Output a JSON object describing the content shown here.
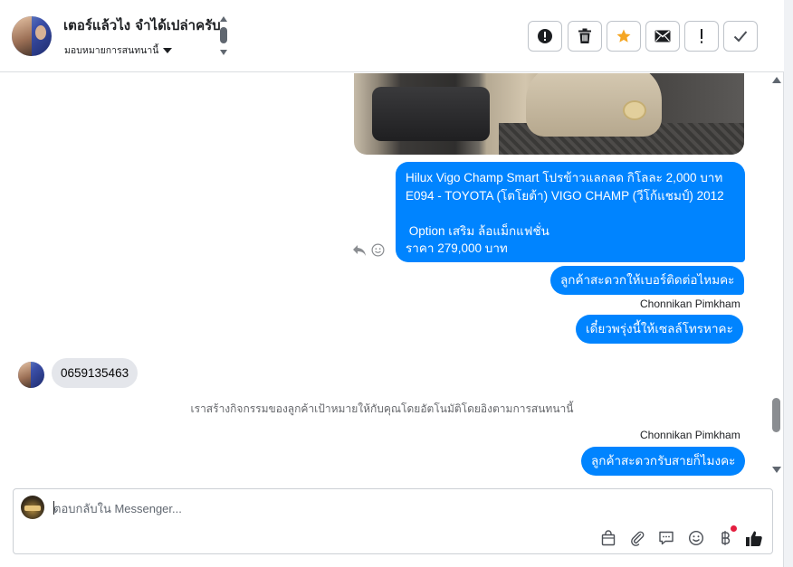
{
  "header": {
    "title": "เตอร์แล้วไง จำได้เปล่าครับ",
    "subtitle": "มอบหมายการสนทนานี้",
    "tools": [
      {
        "name": "mark-spam",
        "icon": "alert-circle-icon"
      },
      {
        "name": "delete",
        "icon": "trash-icon"
      },
      {
        "name": "star",
        "icon": "star-icon",
        "color": "#f5a623"
      },
      {
        "name": "mark-unread",
        "icon": "envelope-icon"
      },
      {
        "name": "follow-up",
        "icon": "exclamation-icon"
      },
      {
        "name": "done",
        "icon": "check-icon"
      }
    ]
  },
  "messages": {
    "big_text": "Hilux Vigo Champ Smart โปรข้าวแลกลด กิโลละ 2,000 บาท\nE094 - TOYOTA (โตโยต้า) VIGO CHAMP (วีโก้แชมป์) 2012\n\n Option เสริม ล้อแม็กแฟชั่น\nราคา 279,000 บาท",
    "out_1": "ลูกค้าสะดวกให้เบอร์ติดต่อไหมคะ",
    "sender_1": "Chonnikan Pimkham",
    "out_2": "เดี๋ยวพรุ่งนี้ให้เซลล์โทรหาคะ",
    "in_1": "0659135463",
    "system_note": "เราสร้างกิจกรรมของลูกค้าเป้าหมายให้กับคุณโดยอัตโนมัติโดยอิงตามการสนทนานี้",
    "sender_2": "Chonnikan Pimkham",
    "out_3": "ลูกค้าสะดวกรับสายก็ไมงคะ"
  },
  "composer": {
    "placeholder": "ตอบกลับใน Messenger...",
    "icons": [
      "shopping-bag-icon",
      "paperclip-icon",
      "saved-reply-icon",
      "emoji-icon",
      "baht-icon",
      "thumbs-up-icon"
    ]
  },
  "colors": {
    "outgoing_bubble": "#0084ff",
    "incoming_bubble": "#e4e6eb",
    "star": "#f5a623",
    "notification_dot": "#e41e3f"
  }
}
